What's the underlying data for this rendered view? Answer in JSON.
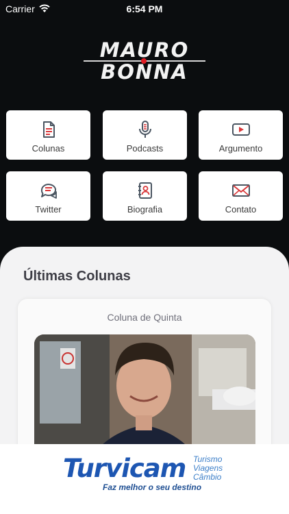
{
  "status_bar": {
    "carrier": "Carrier",
    "time": "6:54 PM"
  },
  "logo": {
    "line1": "MAURO",
    "line2": "BONNA",
    "accent_color": "#e21b23"
  },
  "menu": [
    {
      "label": "Colunas",
      "icon": "document-icon"
    },
    {
      "label": "Podcasts",
      "icon": "microphone-icon"
    },
    {
      "label": "Argumento",
      "icon": "video-play-icon"
    },
    {
      "label": "Twitter",
      "icon": "chat-bubbles-icon"
    },
    {
      "label": "Biografia",
      "icon": "contact-book-icon"
    },
    {
      "label": "Contato",
      "icon": "envelope-icon"
    }
  ],
  "latest": {
    "title": "Últimas Colunas",
    "card": {
      "caption": "Coluna de Quinta"
    }
  },
  "ad": {
    "brand": "Turvicam",
    "services": [
      "Turismo",
      "Viagens",
      "Câmbio"
    ],
    "tagline": "Faz melhor o seu destino"
  },
  "colors": {
    "background": "#0b0d0f",
    "accent": "#d9383a",
    "sheet": "#f3f3f4"
  }
}
